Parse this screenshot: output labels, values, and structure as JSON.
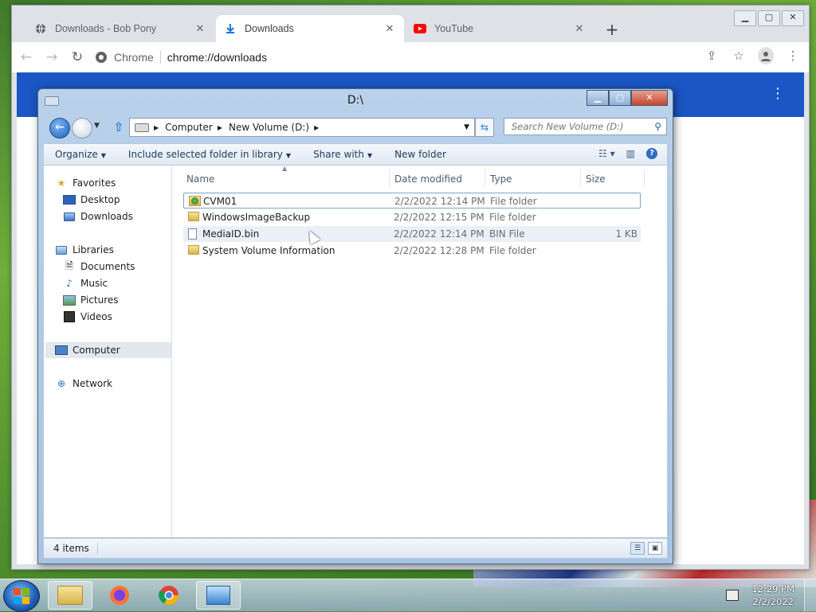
{
  "browser": {
    "tabs": [
      {
        "label": "Downloads - Bob Pony",
        "icon": "globe-icon",
        "close": "✕"
      },
      {
        "label": "Downloads",
        "icon": "download-icon",
        "close": "✕"
      },
      {
        "label": "YouTube",
        "icon": "youtube-icon",
        "close": "✕"
      }
    ],
    "new_tab": "+",
    "window_controls": {
      "minimize": "▁",
      "maximize": "▢",
      "close": "✕"
    },
    "chip": "Chrome",
    "url": "chrome://downloads"
  },
  "explorer": {
    "title": "D:\\",
    "address": {
      "crumbs": [
        "Computer",
        "New Volume (D:)"
      ]
    },
    "search_placeholder": "Search New Volume (D:)",
    "commands": [
      "Organize",
      "Include selected folder in library",
      "Share with",
      "New folder"
    ],
    "nav": {
      "favorites": {
        "label": "Favorites",
        "items": [
          "Desktop",
          "Downloads"
        ]
      },
      "libraries": {
        "label": "Libraries",
        "items": [
          "Documents",
          "Music",
          "Pictures",
          "Videos"
        ]
      },
      "computer": "Computer",
      "network": "Network"
    },
    "columns": {
      "name": "Name",
      "date": "Date modified",
      "type": "Type",
      "size": "Size"
    },
    "files": [
      {
        "name": "CVM01",
        "date": "2/2/2022 12:14 PM",
        "type": "File folder",
        "size": ""
      },
      {
        "name": "WindowsImageBackup",
        "date": "2/2/2022 12:15 PM",
        "type": "File folder",
        "size": ""
      },
      {
        "name": "MediaID.bin",
        "date": "2/2/2022 12:14 PM",
        "type": "BIN File",
        "size": "1 KB"
      },
      {
        "name": "System Volume Information",
        "date": "2/2/2022 12:28 PM",
        "type": "File folder",
        "size": ""
      }
    ],
    "status": "4 items"
  },
  "taskbar": {
    "items": [
      "windows-explorer",
      "firefox",
      "chrome",
      "control-panel"
    ],
    "clock": {
      "time": "12:29 PM",
      "date": "2/2/2022"
    }
  }
}
